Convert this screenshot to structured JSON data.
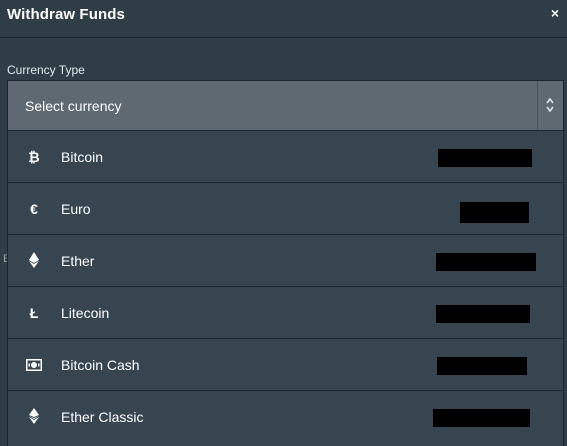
{
  "modal": {
    "title": "Withdraw Funds",
    "close_label": "×"
  },
  "form": {
    "currency_label": "Currency Type",
    "select_value": "Select currency",
    "background_hint": "E"
  },
  "options": [
    {
      "label": "Bitcoin",
      "icon": "bitcoin-icon",
      "icon_glyph": "₿"
    },
    {
      "label": "Euro",
      "icon": "euro-icon",
      "icon_glyph": "€"
    },
    {
      "label": "Ether",
      "icon": "ether-icon",
      "icon_glyph": ""
    },
    {
      "label": "Litecoin",
      "icon": "litecoin-icon",
      "icon_glyph": "Ł"
    },
    {
      "label": "Bitcoin Cash",
      "icon": "cash-icon",
      "icon_glyph": ""
    },
    {
      "label": "Ether Classic",
      "icon": "ether-classic-icon",
      "icon_glyph": ""
    }
  ],
  "colors": {
    "background": "#2f3d47",
    "select_bg": "#5e6971",
    "dropdown_bg": "#36454f",
    "text": "#ffffff"
  }
}
